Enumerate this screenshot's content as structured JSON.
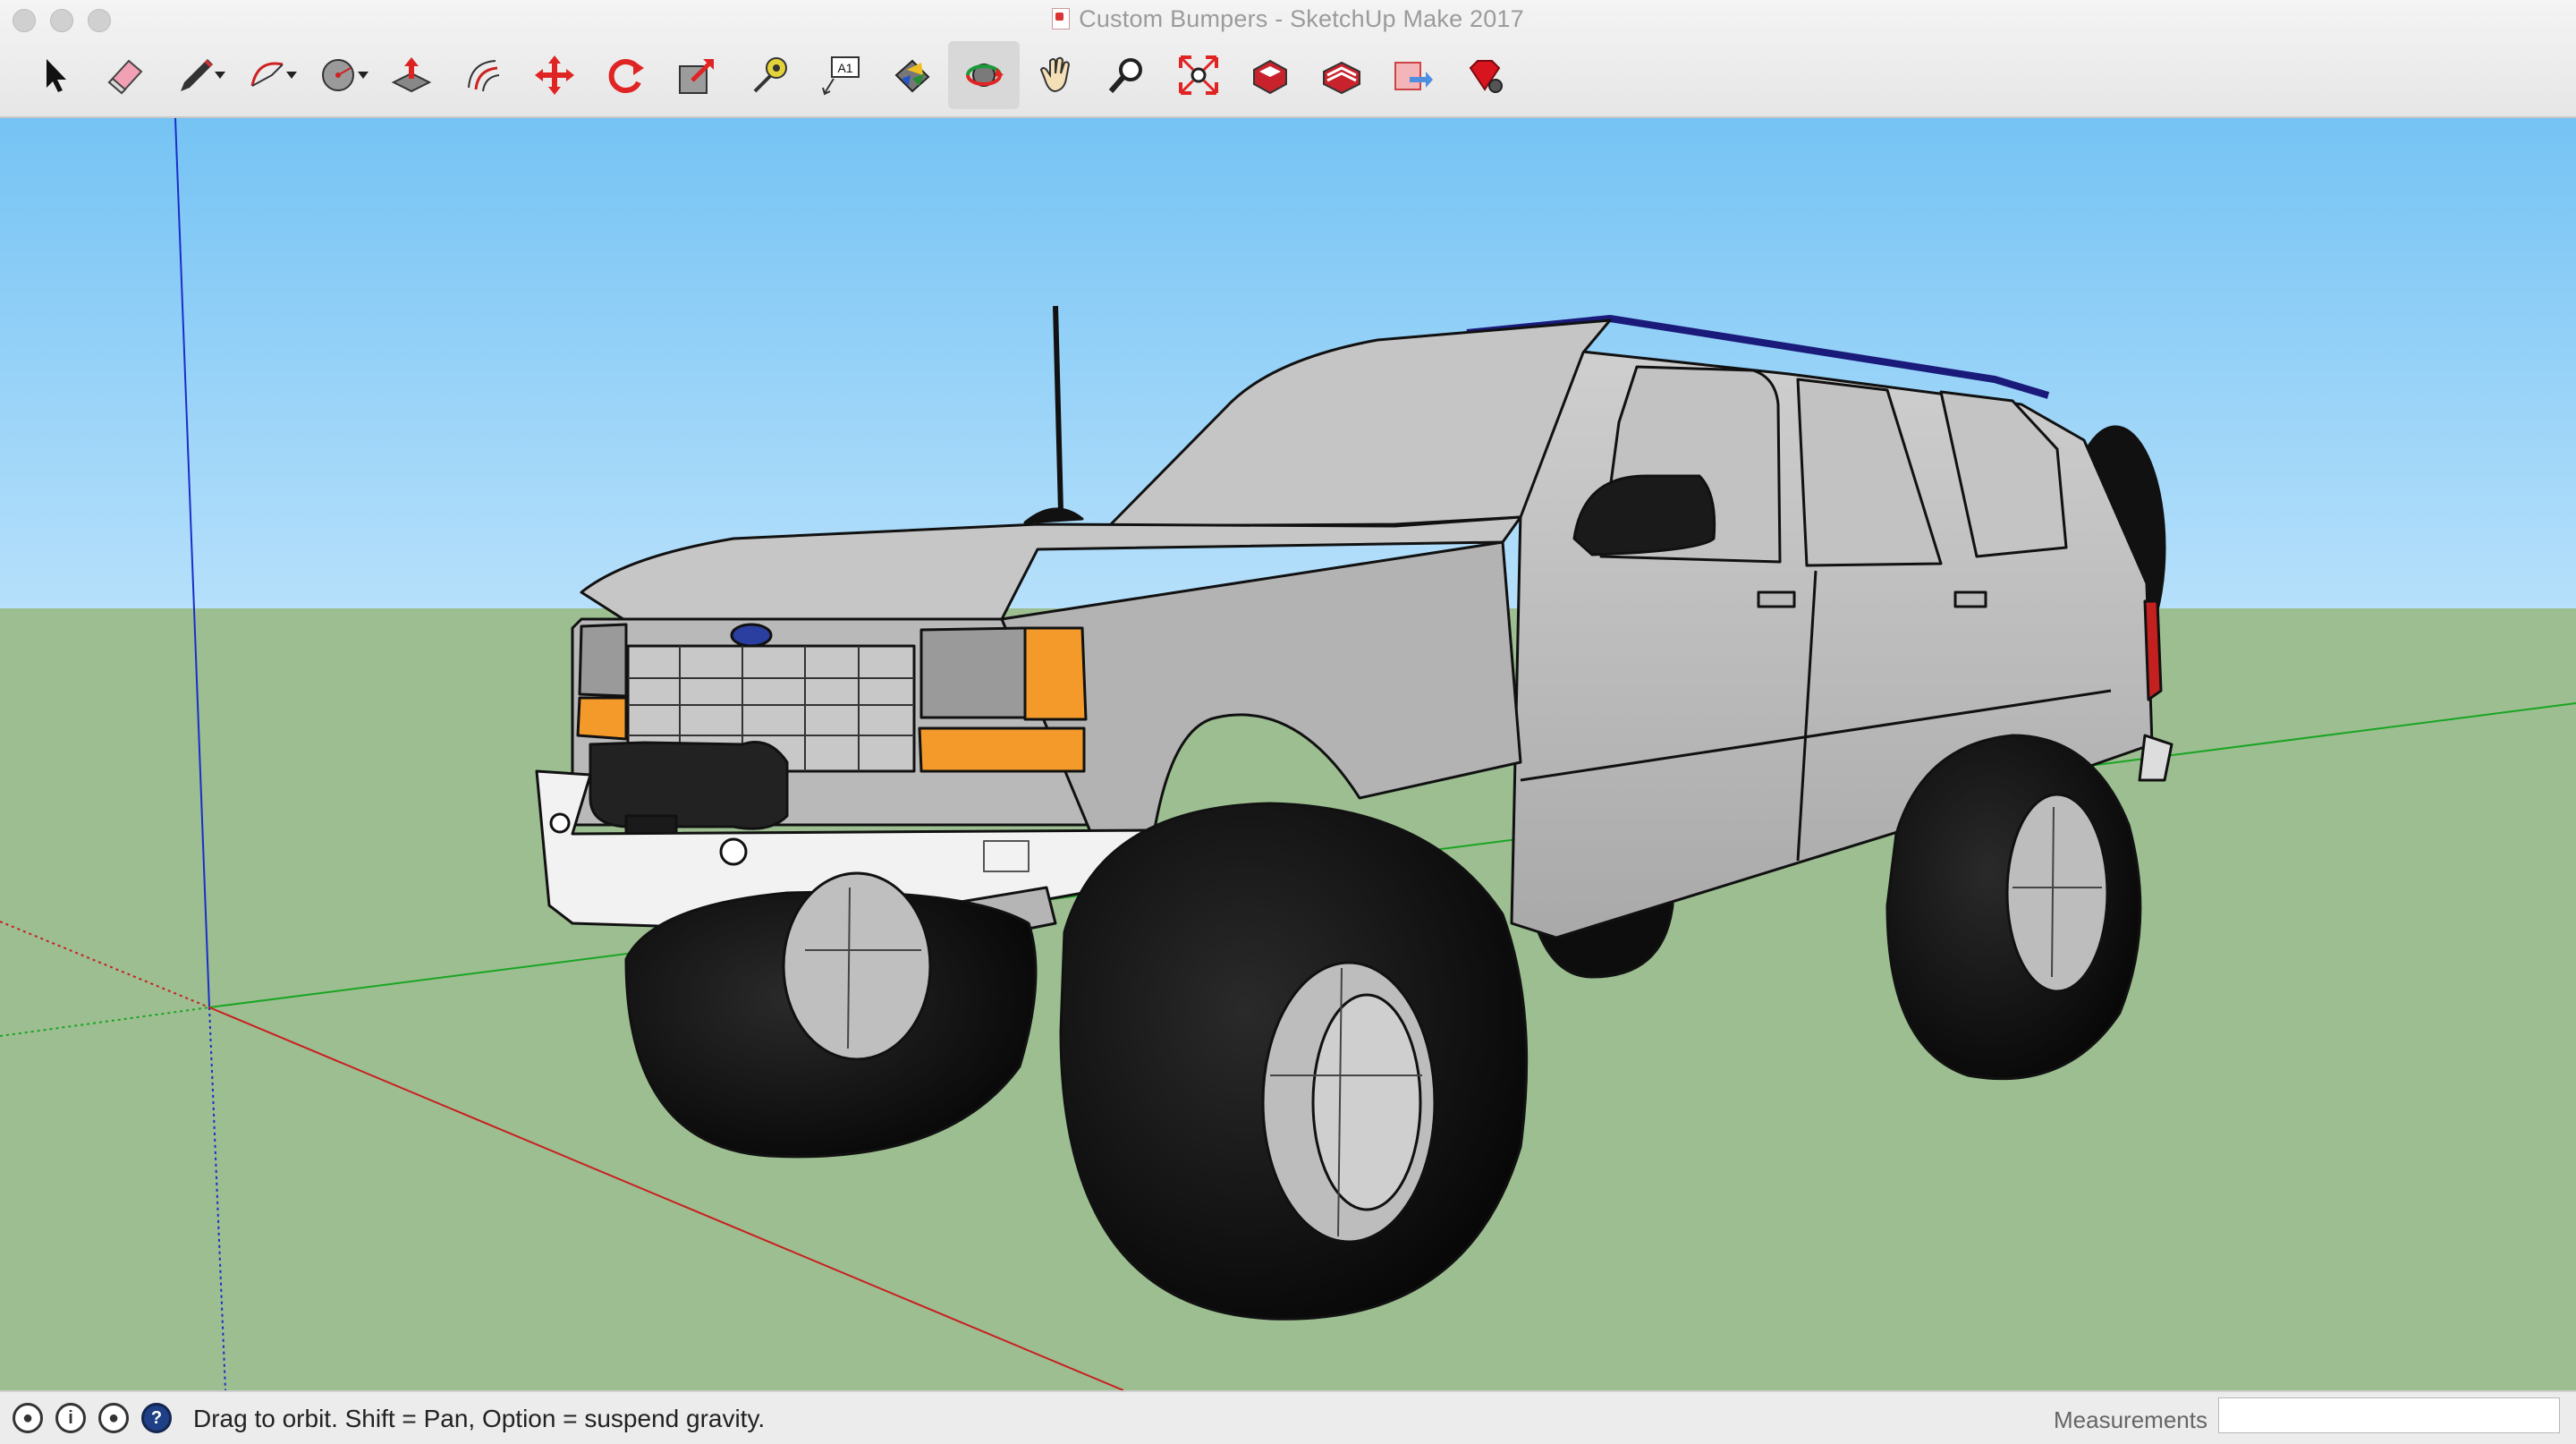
{
  "window": {
    "title": "Custom Bumpers - SketchUp Make 2017"
  },
  "toolbar": {
    "tools": [
      {
        "name": "select-tool",
        "icon": "arrow-pointer-icon"
      },
      {
        "name": "eraser-tool",
        "icon": "eraser-icon"
      },
      {
        "name": "line-tool",
        "icon": "pencil-icon"
      },
      {
        "name": "arc-tool",
        "icon": "arc-icon"
      },
      {
        "name": "shapes-tool",
        "icon": "circle-shape-icon"
      },
      {
        "name": "push-pull-tool",
        "icon": "push-pull-icon"
      },
      {
        "name": "offset-tool",
        "icon": "offset-icon"
      },
      {
        "name": "move-tool",
        "icon": "move-arrows-icon"
      },
      {
        "name": "rotate-tool",
        "icon": "rotate-icon"
      },
      {
        "name": "scale-tool",
        "icon": "scale-icon"
      },
      {
        "name": "tape-measure-tool",
        "icon": "tape-measure-icon"
      },
      {
        "name": "text-tool",
        "icon": "text-label-icon"
      },
      {
        "name": "paint-bucket-tool",
        "icon": "paint-bucket-icon"
      },
      {
        "name": "orbit-tool",
        "icon": "orbit-icon",
        "active": true
      },
      {
        "name": "pan-tool",
        "icon": "hand-icon"
      },
      {
        "name": "zoom-tool",
        "icon": "magnifier-icon"
      },
      {
        "name": "zoom-extents-tool",
        "icon": "zoom-extents-icon"
      },
      {
        "name": "warehouse-tool",
        "icon": "3d-warehouse-icon"
      },
      {
        "name": "extension-warehouse-tool",
        "icon": "extension-warehouse-icon"
      },
      {
        "name": "share-model-tool",
        "icon": "share-model-icon"
      },
      {
        "name": "ruby-console-tool",
        "icon": "ruby-gem-icon"
      }
    ],
    "text_tool_glyph": "A1"
  },
  "statusbar": {
    "hint": "Drag to orbit. Shift = Pan, Option = suspend gravity.",
    "measurements_label": "Measurements",
    "measurements_value": "",
    "help_glyph": "?",
    "info_glyph": "i"
  },
  "scene": {
    "sky_color": "#86cbf6",
    "ground_color": "#9cbe91",
    "model_color": "#bcbcbc",
    "headlight_color": "#f39a2b"
  }
}
